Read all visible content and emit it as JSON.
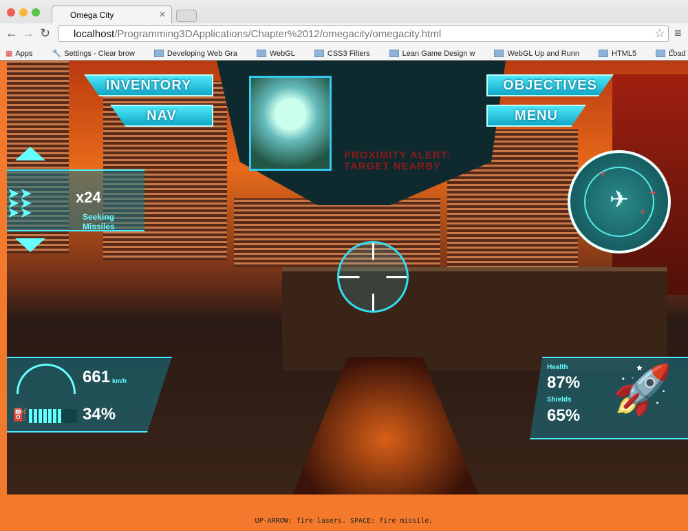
{
  "browser": {
    "tab_title": "Omega City",
    "url_host": "localhost",
    "url_path": "/Programming3DApplications/Chapter%2012/omegacity/omegacity.html",
    "bookmarks": [
      "Apps",
      "Settings - Clear brow",
      "Developing Web Gra",
      "WebGL",
      "CSS3 Filters",
      "Lean Game Design w",
      "WebGL Up and Runn",
      "HTML5",
      "Load Testing"
    ],
    "more": "»"
  },
  "hud": {
    "inventory": "INVENTORY",
    "nav": "NAV",
    "objectives": "OBJECTIVES",
    "menu": "MENU",
    "alert_line1": "PROXIMITY ALERT:",
    "alert_line2": "TARGET NEARBY",
    "missile_count": "x24",
    "missile_type": "Seeking Missiles",
    "speed": "661",
    "speed_unit": "km/h",
    "fuel": "34%",
    "fuel_level": 0.7,
    "health_label": "Health",
    "health": "87%",
    "shields_label": "Shields",
    "shields": "65%"
  },
  "accent": "#4ee8f8",
  "footer": "UP-ARROW: fire lasers. SPACE: fire missile."
}
